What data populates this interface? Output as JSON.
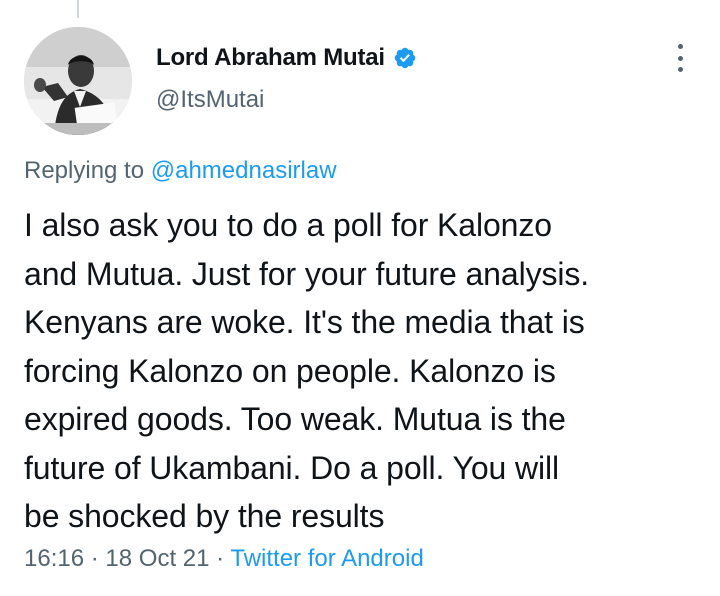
{
  "author": {
    "display_name": "Lord Abraham Mutai",
    "handle": "@ItsMutai"
  },
  "reply": {
    "prefix": "Replying to",
    "to_handle": "@ahmednasirlaw"
  },
  "tweet": {
    "lines": [
      "I also ask you to do a poll for Kalonzo",
      "and Mutua. Just for your future analysis.",
      "Kenyans are woke. It's the media that is",
      "forcing Kalonzo on people. Kalonzo is",
      "expired goods. Too weak. Mutua is the",
      "future of Ukambani. Do a poll. You will",
      "be shocked by the results"
    ]
  },
  "meta": {
    "time": "16:16",
    "separator": "·",
    "date": "18 Oct 21",
    "source": "Twitter for Android"
  },
  "icons": {
    "verified": "verified-badge-icon",
    "more": "more-options-icon"
  },
  "colors": {
    "link": "#1d9bf0",
    "secondary_text": "#536471",
    "primary_text": "#0f1419",
    "thread_line": "#cfd9de"
  }
}
